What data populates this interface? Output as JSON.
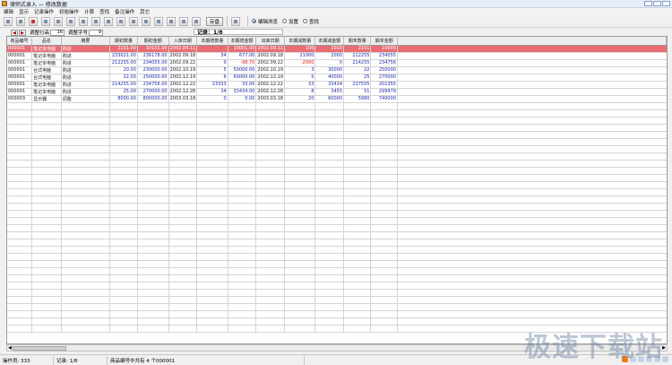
{
  "window": {
    "title": "律师式录入 — 修改数据"
  },
  "menu": [
    "编辑",
    "显示",
    "记录操作",
    "初始操作",
    "计算",
    "查找",
    "备注操作",
    "其它"
  ],
  "toolbar": {
    "icons": [
      "new-icon",
      "copy-icon",
      "delete-icon",
      "cut-icon",
      "paste-icon",
      "first-icon",
      "prev-icon",
      "next-icon",
      "last-icon",
      "insert-icon",
      "move-up-icon",
      "move-down-icon",
      "sort-icon",
      "undo-icon",
      "redo-icon",
      "refresh-icon"
    ],
    "save_label": "存盘",
    "radios": [
      {
        "label": "编辑浏览",
        "checked": true
      },
      {
        "label": "设置",
        "checked": false
      },
      {
        "label": "查找",
        "checked": false
      }
    ]
  },
  "nav": {
    "row_height_label": "调整行高",
    "row_height_value": "16",
    "font_size_label": "调整字号",
    "font_size_value": "9",
    "record_text": "记录：1/8"
  },
  "table": {
    "columns": [
      "商品编号",
      "品名",
      "摘要",
      "期初数量",
      "期初金额",
      "入库日期",
      "本期增数量",
      "本期增金额",
      "出库日期",
      "本期减数量",
      "本期减金额",
      "期末数量",
      "期末金额"
    ],
    "rows": [
      [
        "000001",
        "笔记本电脑",
        "购进",
        "2101.00",
        "10101.00",
        "2002.09.11",
        "",
        "10001.00",
        "2002.09.11",
        "100",
        "2010",
        "2101",
        "10000"
      ],
      [
        "000001",
        "笔记本电脑",
        "购进",
        "233021.00",
        "236178.00",
        "2002.09.18",
        "34",
        "677.00",
        "2002.09.18",
        "21000",
        "2000",
        "212255",
        "234055"
      ],
      [
        "000001",
        "笔记本电脑",
        "购进",
        "212255.00",
        "234055.00",
        "2002.09.22",
        "0",
        "-98.70",
        "2002.09.22",
        "-2000",
        "0",
        "214255",
        "234756"
      ],
      [
        "000001",
        "台式电脑",
        "购进",
        "20.00",
        "230000.00",
        "2002.10.19",
        "5",
        "50000.00",
        "2002.10.19",
        "3",
        "30000",
        "22",
        "250000"
      ],
      [
        "000001",
        "台式电脑",
        "购进",
        "22.00",
        "250000.00",
        "2002.12.19",
        "6",
        "60000.00",
        "2002.12.19",
        "5",
        "40000",
        "25",
        "270000"
      ],
      [
        "000001",
        "笔记本电脑",
        "购进",
        "214255.00",
        "234756.00",
        "2002.12.22",
        "23333",
        "33.00",
        "2002.12.22",
        "33",
        "33434",
        "237555",
        "201355"
      ],
      [
        "000001",
        "笔记本电脑",
        "购进",
        "25.00",
        "270000.00",
        "2002.12.28",
        "34",
        "33434.00",
        "2002.12.28",
        "8",
        "3455",
        "51",
        "299979"
      ],
      [
        "000003",
        "显示器",
        "调整",
        "8000.00",
        "800000.00",
        "2003.03.18",
        "0",
        "0.00",
        "2003.03.18",
        "20",
        "60000",
        "5980",
        "740000"
      ]
    ],
    "negative_cells": [
      [
        2,
        7
      ],
      [
        2,
        9
      ]
    ]
  },
  "status": {
    "cells": [
      "操作员: 333",
      "记录: 1/8",
      "商品编号中共有 4 个000001"
    ]
  },
  "watermark": "极速下载站",
  "colors": {
    "selected_row": "#e96d73",
    "number_text": "#1a2aa8",
    "negative_text": "#d11111"
  }
}
